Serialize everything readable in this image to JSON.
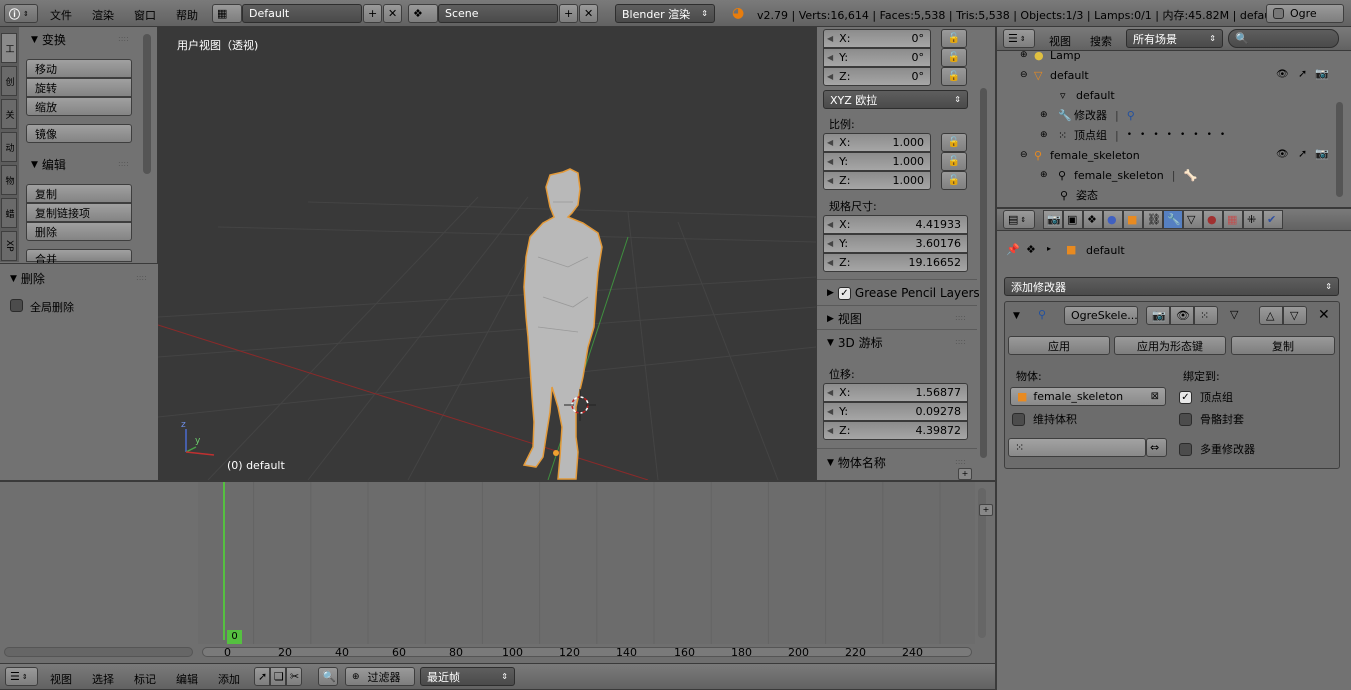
{
  "header": {
    "menus": [
      "文件",
      "渲染",
      "窗口",
      "帮助"
    ],
    "screen_layout": "Default",
    "scene": "Scene",
    "render_engine": "Blender 渲染",
    "stats": "v2.79 | Verts:16,614 | Faces:5,538 | Tris:5,538 | Objects:1/3 | Lamps:0/1 | 内存:45.82M | default",
    "ogre_label": "Ogre"
  },
  "toolshelf": {
    "tabs": [
      "工",
      "创",
      "关",
      "动",
      "物",
      "蜡",
      "XP"
    ],
    "transform_title": "变换",
    "move": "移动",
    "rotate": "旋转",
    "scale": "缩放",
    "mirror": "镜像",
    "edit_title": "编辑",
    "duplicate": "复制",
    "duplicate_linked": "复制链接项",
    "delete": "删除",
    "join": "合并",
    "op_title": "删除",
    "global_delete": "全局删除"
  },
  "viewport": {
    "title": "用户视图（透视)",
    "object_label": "(0) default",
    "axis_y": "y",
    "axis_z": "z"
  },
  "npanel": {
    "rot_x": "0°",
    "rot_y": "0°",
    "rot_z": "0°",
    "rotation_mode": "XYZ 欧拉",
    "scale_label": "比例:",
    "scale_x": "1.000",
    "scale_y": "1.000",
    "scale_z": "1.000",
    "dims_label": "规格尺寸:",
    "dim_x": "4.41933",
    "dim_y": "3.60176",
    "dim_z": "19.16652",
    "grease": "Grease Pencil Layers",
    "view": "视图",
    "cursor": "3D 游标",
    "location_label": "位移:",
    "loc_x": "1.56877",
    "loc_y": "0.09278",
    "loc_z": "4.39872",
    "object_name": "物体名称",
    "x": "X:",
    "y": "Y:",
    "z": "Z:"
  },
  "outliner": {
    "menus": [
      "视图",
      "搜索"
    ],
    "scenes": "所有场景",
    "rows": [
      {
        "label": "Lamp"
      },
      {
        "label": "default"
      },
      {
        "label": "default"
      },
      {
        "label": "修改器"
      },
      {
        "label": "顶点组"
      },
      {
        "label": "female_skeleton"
      },
      {
        "label": "female_skeleton"
      },
      {
        "label": "姿态"
      }
    ]
  },
  "properties": {
    "breadcrumb": "default",
    "add_modifier": "添加修改器",
    "modifier_name": "OgreSkele...",
    "apply": "应用",
    "apply_shape": "应用为形态键",
    "copy": "复制",
    "object_label": "物体:",
    "object_value": "female_skeleton",
    "bind_label": "绑定到:",
    "vertex_groups": "顶点组",
    "preserve_volume": "维持体积",
    "bone_envelopes": "骨骼封套",
    "multi_modifier": "多重修改器"
  },
  "timeline": {
    "current_frame": "0",
    "ticks": [
      "0",
      "20",
      "40",
      "60",
      "80",
      "100",
      "120",
      "140",
      "160",
      "180",
      "200",
      "220",
      "240"
    ],
    "menus": [
      "视图",
      "选择",
      "标记",
      "编辑",
      "添加"
    ],
    "filter": "过滤器",
    "keying": "最近帧"
  }
}
